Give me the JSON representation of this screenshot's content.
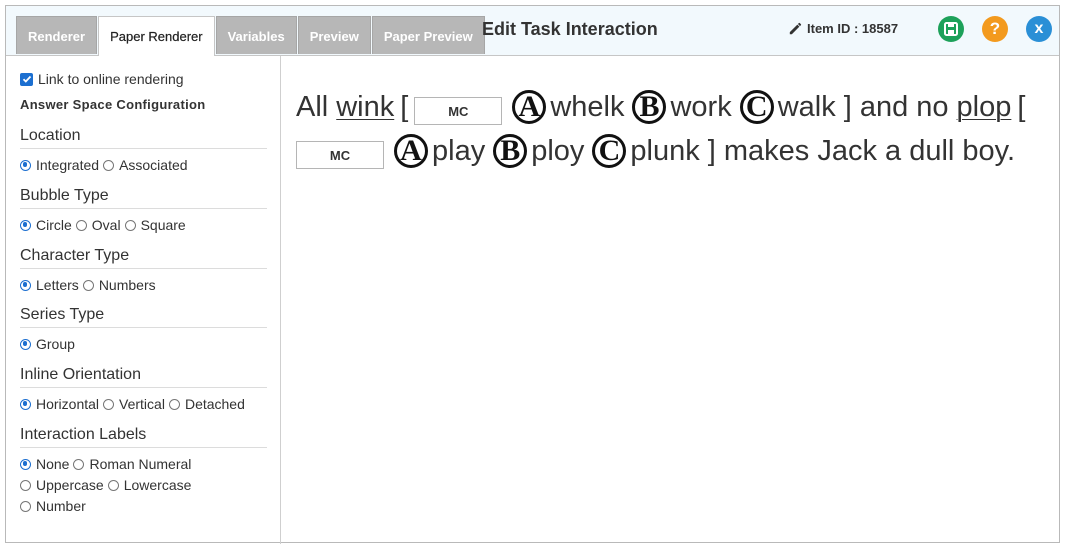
{
  "tabs": [
    {
      "label": "Renderer",
      "active": false
    },
    {
      "label": "Paper Renderer",
      "active": true
    },
    {
      "label": "Variables",
      "active": false
    },
    {
      "label": "Preview",
      "active": false
    },
    {
      "label": "Paper Preview",
      "active": false
    }
  ],
  "header": {
    "title": "Edit Task Interaction",
    "item_id": "Item ID : 18587",
    "save_icon": "save-icon",
    "help_label": "?",
    "close_label": "x"
  },
  "sidebar": {
    "link_online_label": "Link to online rendering",
    "link_online_checked": true,
    "answer_space_title": "Answer Space Configuration",
    "location": {
      "title": "Location",
      "options": [
        "Integrated",
        "Associated"
      ],
      "selected": "Integrated"
    },
    "bubble_type": {
      "title": "Bubble Type",
      "options": [
        "Circle",
        "Oval",
        "Square"
      ],
      "selected": "Circle"
    },
    "character_type": {
      "title": "Character Type",
      "options": [
        "Letters",
        "Numbers"
      ],
      "selected": "Letters"
    },
    "series_type": {
      "title": "Series Type",
      "options": [
        "Group"
      ],
      "selected": "Group"
    },
    "inline_orientation": {
      "title": "Inline Orientation",
      "options": [
        "Horizontal",
        "Vertical",
        "Detached"
      ],
      "selected": "Horizontal"
    },
    "interaction_labels": {
      "title": "Interaction Labels",
      "options": [
        "None",
        "Roman Numeral",
        "Uppercase",
        "Lowercase",
        "Number"
      ],
      "selected": "None"
    }
  },
  "content": {
    "line1": {
      "w_all": "All",
      "w_wink": "wink",
      "bracket_open": "[",
      "mc": "MC",
      "a": "A",
      "opt_a": "whelk",
      "b": "B",
      "opt_b": "work",
      "c": "C",
      "opt_c": "walk",
      "tail": "] and no",
      "w_plop": "plop",
      "bracket_open2": "["
    },
    "line2": {
      "mc": "MC",
      "a": "A",
      "opt_a": "play",
      "b": "B",
      "opt_b": "ploy",
      "c": "C",
      "opt_c": "plunk",
      "tail": "] makes Jack a dull boy."
    }
  }
}
